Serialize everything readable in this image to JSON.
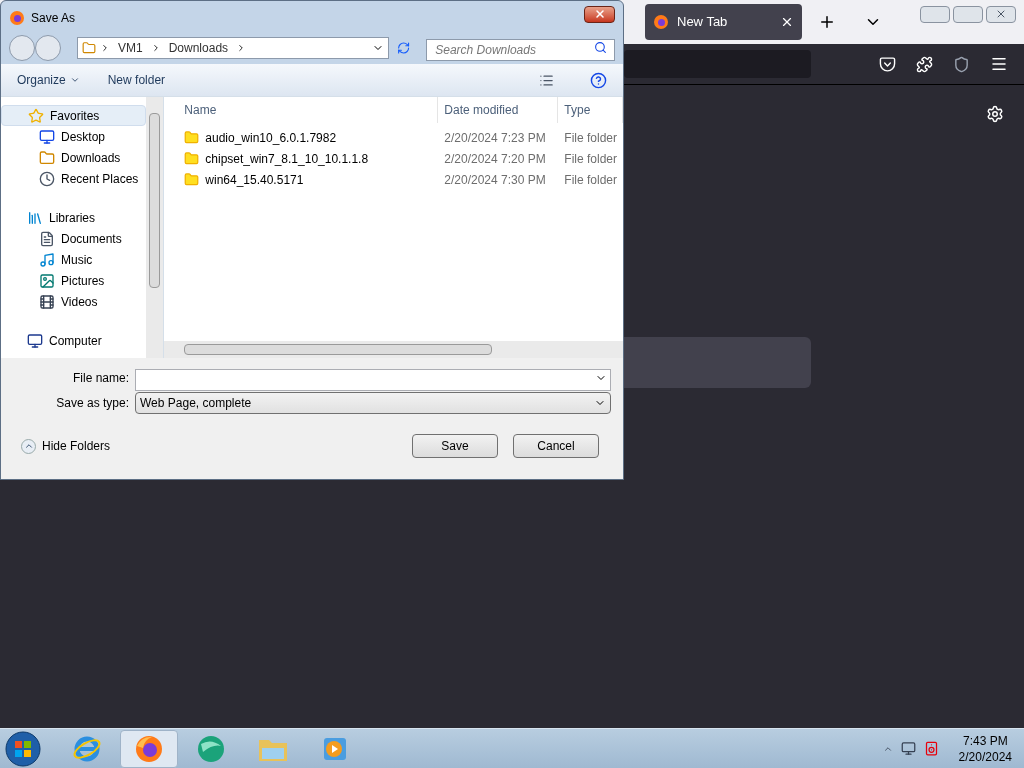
{
  "browser": {
    "tabs": [
      {
        "title": "New Tab",
        "selected": true
      }
    ]
  },
  "dialog": {
    "title": "Save As",
    "address": [
      "VM1",
      "Downloads"
    ],
    "search": {
      "placeholder": "Search Downloads"
    },
    "toolbar": [
      "Organize",
      "New folder"
    ],
    "nav": [
      {
        "label": "Favorites",
        "kind": "favorites",
        "selected": true,
        "children": [
          {
            "label": "Desktop",
            "kind": "desktop",
            "selected": false
          },
          {
            "label": "Downloads",
            "kind": "downloads",
            "selected": false
          },
          {
            "label": "Recent Places",
            "kind": "recent",
            "selected": false
          }
        ]
      },
      {
        "label": "Libraries",
        "kind": "libraries",
        "selected": false,
        "children": [
          {
            "label": "Documents",
            "kind": "documents",
            "selected": false
          },
          {
            "label": "Music",
            "kind": "music",
            "selected": false
          },
          {
            "label": "Pictures",
            "kind": "pictures",
            "selected": false
          },
          {
            "label": "Videos",
            "kind": "videos",
            "selected": false
          }
        ]
      },
      {
        "label": "Computer",
        "kind": "computer",
        "selected": false
      }
    ],
    "columns": [
      "Name",
      "Date modified",
      "Type"
    ],
    "rows": [
      [
        "audio_win10_6.0.1.7982",
        "2/20/2024 7:23 PM",
        "File folder"
      ],
      [
        "chipset_win7_8.1_10_10.1.1.8",
        "2/20/2024 7:20 PM",
        "File folder"
      ],
      [
        "win64_15.40.5171",
        "2/20/2024 7:30 PM",
        "File folder"
      ]
    ],
    "file_name": {
      "label": "File name:"
    },
    "save_type": {
      "label": "Save as type:",
      "value": "Web Page, complete"
    },
    "hide_folders": "Hide Folders",
    "buttons": [
      "Save",
      "Cancel"
    ]
  },
  "taskbar": {
    "apps": [
      {
        "kind": "ie",
        "selected": false
      },
      {
        "kind": "firefox",
        "selected": true
      },
      {
        "kind": "globe",
        "selected": false
      },
      {
        "kind": "explorer",
        "selected": false
      },
      {
        "kind": "media",
        "selected": false
      }
    ],
    "time": "7:43 PM",
    "date": "2/20/2024"
  }
}
